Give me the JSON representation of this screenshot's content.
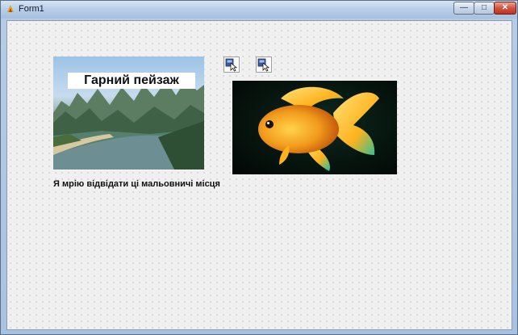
{
  "window": {
    "title": "Form1",
    "controls": {
      "minimize": "—",
      "maximize": "□",
      "close": "✕"
    }
  },
  "form": {
    "landscape_title": "Гарний пейзаж",
    "caption": "Я мрію відвідати ці мальовничі місця"
  },
  "icons": [
    "form-icon",
    "image-button-icon",
    "image-button-icon"
  ]
}
